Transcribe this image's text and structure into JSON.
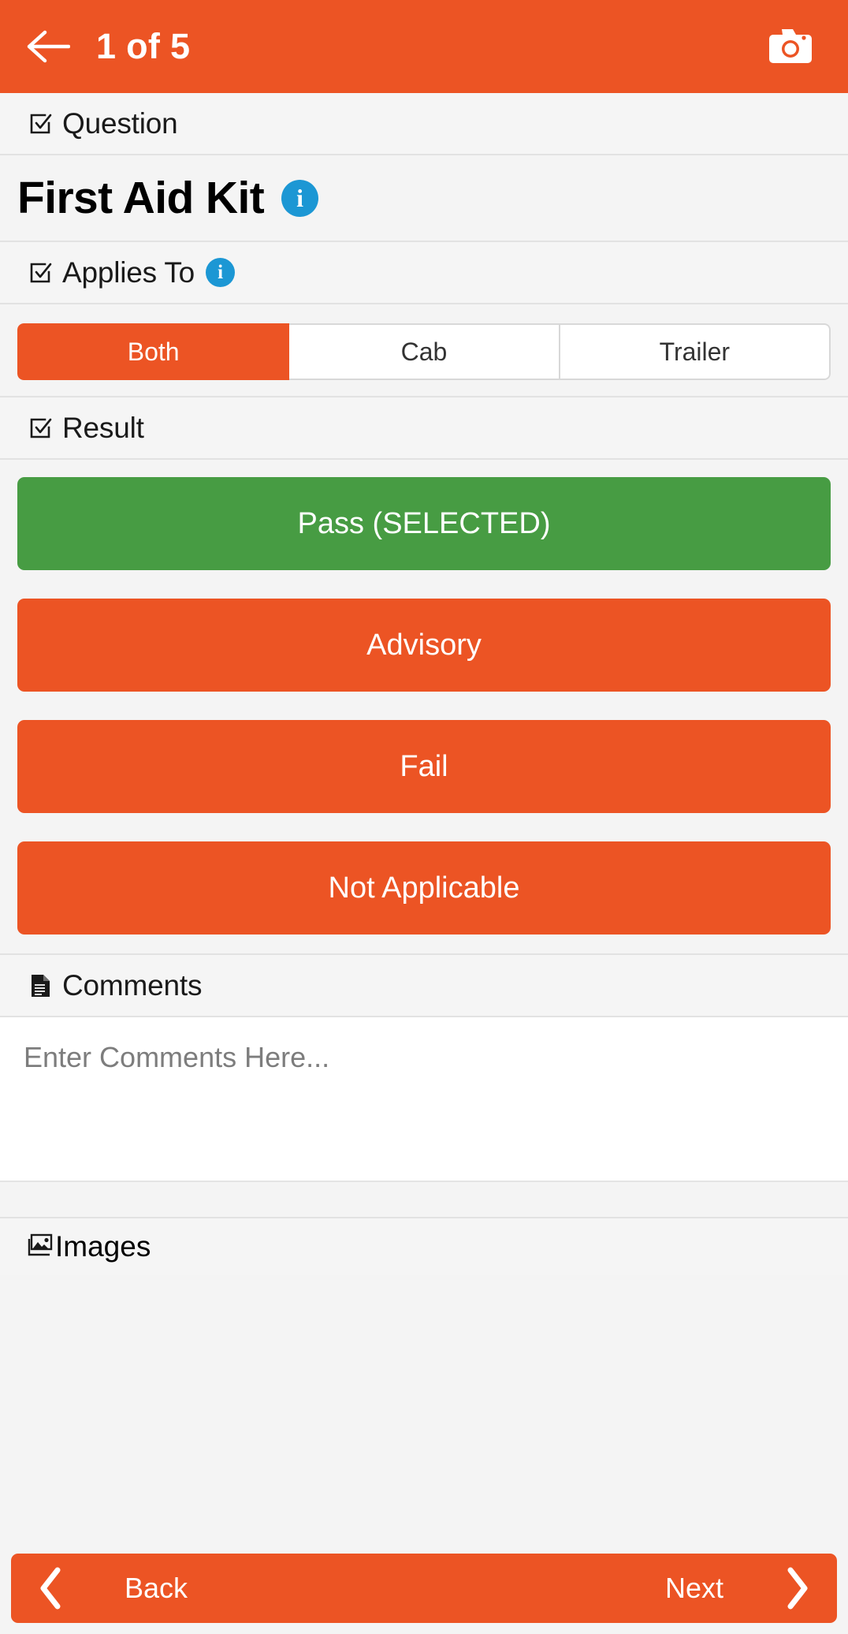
{
  "appbar": {
    "back_icon": "arrow-left-icon",
    "title": "1 of 5",
    "camera_icon": "camera-icon",
    "background_color": "#ec5424"
  },
  "sections": {
    "question": {
      "header_label": "Question",
      "header_icon": "checkbox-checked-icon",
      "title": "First Aid Kit",
      "info_badge": "i"
    },
    "applies_to": {
      "header_label": "Applies To",
      "header_icon": "checkbox-checked-icon",
      "info_badge": "i",
      "options": [
        {
          "label": "Both",
          "selected": true
        },
        {
          "label": "Cab",
          "selected": false
        },
        {
          "label": "Trailer",
          "selected": false
        }
      ]
    },
    "result": {
      "header_label": "Result",
      "header_icon": "checkbox-checked-icon",
      "buttons": [
        {
          "label": "Pass (SELECTED)",
          "state": "selected",
          "color": "#479c43"
        },
        {
          "label": "Advisory",
          "state": "default",
          "color": "#ec5424"
        },
        {
          "label": "Fail",
          "state": "default",
          "color": "#ec5424"
        },
        {
          "label": "Not Applicable",
          "state": "default",
          "color": "#ec5424"
        }
      ]
    },
    "comments": {
      "header_label": "Comments",
      "header_icon": "document-icon",
      "placeholder": "Enter Comments Here...",
      "value": ""
    },
    "images": {
      "header_label": "Images",
      "header_icon": "photos-icon"
    }
  },
  "bottom_nav": {
    "back_label": "Back",
    "next_label": "Next",
    "back_icon": "chevron-left-icon",
    "next_icon": "chevron-right-icon",
    "background_color": "#ec5424"
  }
}
